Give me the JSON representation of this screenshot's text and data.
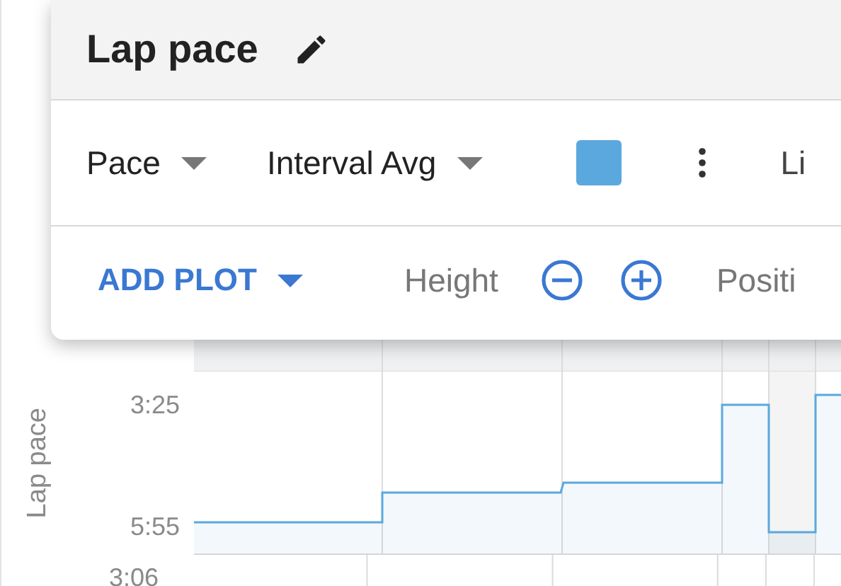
{
  "editor": {
    "title": "Lap pace",
    "metric": "Pace",
    "aggregation": "Interval Avg",
    "color": "#5ba8de",
    "option_cut": "Li",
    "add_plot": "ADD PLOT",
    "height_label": "Height",
    "position_label": "Positi"
  },
  "chart": {
    "ylabel": "Lap pace",
    "ticks": [
      "3:25",
      "5:55"
    ],
    "lower_tick": "3:06"
  }
}
